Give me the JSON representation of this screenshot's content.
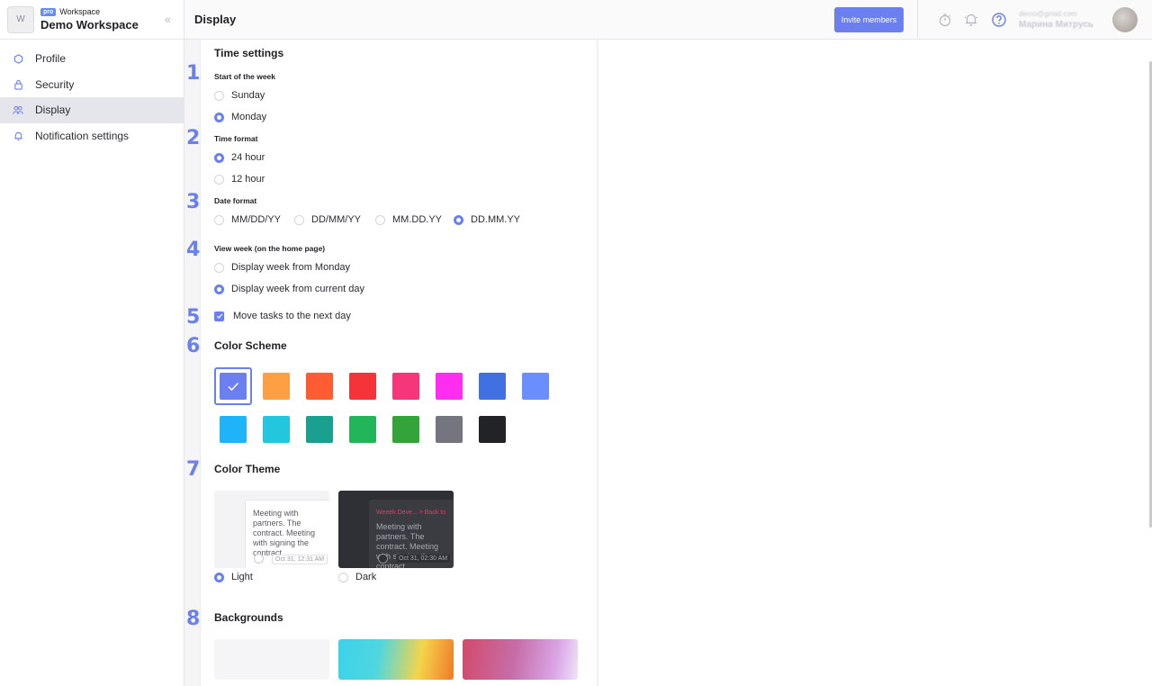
{
  "workspace": {
    "avatar_letter": "W",
    "badge": "pro",
    "type_label": "Workspace",
    "name": "Demo Workspace"
  },
  "sidebar": {
    "collapse_glyph": "«",
    "items": [
      {
        "label": "Profile",
        "icon": "hexagon-icon"
      },
      {
        "label": "Security",
        "icon": "lock-icon"
      },
      {
        "label": "Display",
        "icon": "users-icon",
        "active": true
      },
      {
        "label": "Notification settings",
        "icon": "bell-icon"
      }
    ]
  },
  "header": {
    "title": "Display",
    "invite_label": "Invite members"
  },
  "user": {
    "email": "demo@gmail.com",
    "name": "Марина Митрусь"
  },
  "sections": {
    "time_settings_title": "Time settings",
    "numbers": [
      "1",
      "2",
      "3",
      "4",
      "5",
      "6",
      "7",
      "8"
    ],
    "start_week": {
      "label": "Start of the week",
      "options": [
        "Sunday",
        "Monday"
      ],
      "selected": "Monday"
    },
    "time_format": {
      "label": "Time format",
      "options": [
        "24 hour",
        "12 hour"
      ],
      "selected": "24 hour"
    },
    "date_format": {
      "label": "Date format",
      "options": [
        "MM/DD/YY",
        "DD/MM/YY",
        "MM.DD.YY",
        "DD.MM.YY"
      ],
      "selected": "DD.MM.YY"
    },
    "view_week": {
      "label": "View week (on the home page)",
      "options": [
        "Display week from Monday",
        "Display week from current day"
      ],
      "selected": "Display week from current day"
    },
    "move_tasks": {
      "label": "Move tasks to the next day",
      "checked": true
    },
    "color_scheme": {
      "title": "Color Scheme",
      "colors": [
        "#6b7ff0",
        "#ff9f43",
        "#ff5c33",
        "#f5343a",
        "#f7357a",
        "#ff2df0",
        "#4170e0",
        "#6b8eff",
        "#1eb4f7",
        "#22c7dd",
        "#1aa08f",
        "#22b55a",
        "#34a33a",
        "#74757f",
        "#222326"
      ],
      "selected_index": 0
    },
    "color_theme": {
      "title": "Color Theme",
      "options": [
        {
          "label": "Light",
          "selected": true,
          "preview_text": "Meeting with partners. The contract. Meeting with signing the contract.",
          "date": "Oct 31, 12:31 AM"
        },
        {
          "label": "Dark",
          "selected": false,
          "tag": "Weeek Deve... > Back to",
          "preview_text": "Meeting with partners. The contract. Meeting with signing the contract.",
          "date": "Oct 31, 02:30 AM"
        }
      ]
    },
    "backgrounds": {
      "title": "Backgrounds"
    }
  }
}
